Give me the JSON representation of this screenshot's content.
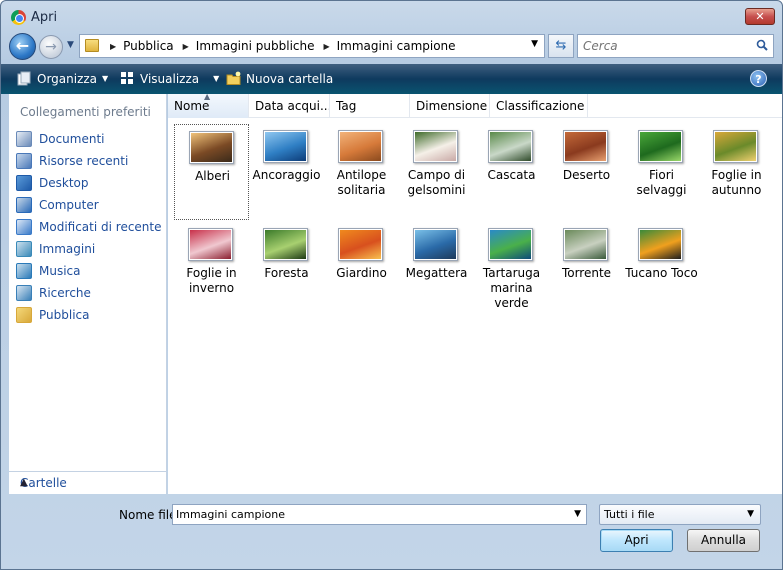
{
  "window": {
    "title": "Apri",
    "close_label": "✕"
  },
  "address": {
    "crumbs": [
      "Pubblica",
      "Immagini pubbliche",
      "Immagini campione"
    ]
  },
  "search": {
    "placeholder": "Cerca"
  },
  "toolbar": {
    "organize": "Organizza",
    "views": "Visualizza",
    "new_folder": "Nuova cartella",
    "help": "?"
  },
  "sidebar": {
    "heading": "Collegamenti preferiti",
    "items": [
      {
        "label": "Documenti",
        "icon": "documents-icon"
      },
      {
        "label": "Risorse recenti",
        "icon": "recent-places-icon"
      },
      {
        "label": "Desktop",
        "icon": "desktop-icon"
      },
      {
        "label": "Computer",
        "icon": "computer-icon"
      },
      {
        "label": "Modificati di recente",
        "icon": "recently-changed-icon"
      },
      {
        "label": "Immagini",
        "icon": "pictures-icon"
      },
      {
        "label": "Musica",
        "icon": "music-icon"
      },
      {
        "label": "Ricerche",
        "icon": "searches-icon"
      },
      {
        "label": "Pubblica",
        "icon": "public-folder-icon"
      }
    ],
    "folders_label": "Cartelle"
  },
  "columns": [
    "Nome",
    "Data acqui...",
    "Tag",
    "Dimensione",
    "Classificazione"
  ],
  "files": [
    {
      "name": "Alberi",
      "colors": [
        "#f0c27a",
        "#7b4a25",
        "#3a2a1a"
      ],
      "selected": true
    },
    {
      "name": "Ancoraggio",
      "colors": [
        "#8fc7f0",
        "#2f7fc4",
        "#0d3c78"
      ],
      "selected": false
    },
    {
      "name": "Antilope solitaria",
      "colors": [
        "#f2b37a",
        "#d67a3a",
        "#8a4a1e"
      ],
      "selected": false
    },
    {
      "name": "Campo di gelsomini",
      "colors": [
        "#3e6b2a",
        "#f5f0e8",
        "#c9a9a6"
      ],
      "selected": false
    },
    {
      "name": "Cascata",
      "colors": [
        "#5a8a4a",
        "#c9d8c8",
        "#2f4a2a"
      ],
      "selected": false
    },
    {
      "name": "Deserto",
      "colors": [
        "#c46a3a",
        "#8a3a1e",
        "#e8a070"
      ],
      "selected": false
    },
    {
      "name": "Fiori selvaggi",
      "colors": [
        "#4aa83a",
        "#1e6a1e",
        "#9ad86a"
      ],
      "selected": false
    },
    {
      "name": "Foglie in autunno",
      "colors": [
        "#d8a83a",
        "#6a8a2a",
        "#f0d070"
      ],
      "selected": false
    },
    {
      "name": "Foglie in inverno",
      "colors": [
        "#c8304a",
        "#f0c8d0",
        "#8a1e2e"
      ],
      "selected": false
    },
    {
      "name": "Foresta",
      "colors": [
        "#3a7a2a",
        "#a8d070",
        "#1e3a14"
      ],
      "selected": false
    },
    {
      "name": "Giardino",
      "colors": [
        "#f08a1e",
        "#d8501e",
        "#f8c050"
      ],
      "selected": false
    },
    {
      "name": "Megattera",
      "colors": [
        "#7ac0e8",
        "#2a6aa8",
        "#1e3a5a"
      ],
      "selected": false
    },
    {
      "name": "Tartaruga marina verde",
      "colors": [
        "#2a8ac8",
        "#4ab04a",
        "#0e4a7a"
      ],
      "selected": false
    },
    {
      "name": "Torrente",
      "colors": [
        "#6a8a5a",
        "#c8d0c0",
        "#3a5a3a"
      ],
      "selected": false
    },
    {
      "name": "Tucano Toco",
      "colors": [
        "#3a8a3a",
        "#f0a01e",
        "#1e1e1e"
      ],
      "selected": false
    }
  ],
  "filename": {
    "label": "Nome file:",
    "value": "Immagini campione"
  },
  "filter": {
    "value": "Tutti i file"
  },
  "buttons": {
    "open": "Apri",
    "cancel": "Annulla"
  }
}
